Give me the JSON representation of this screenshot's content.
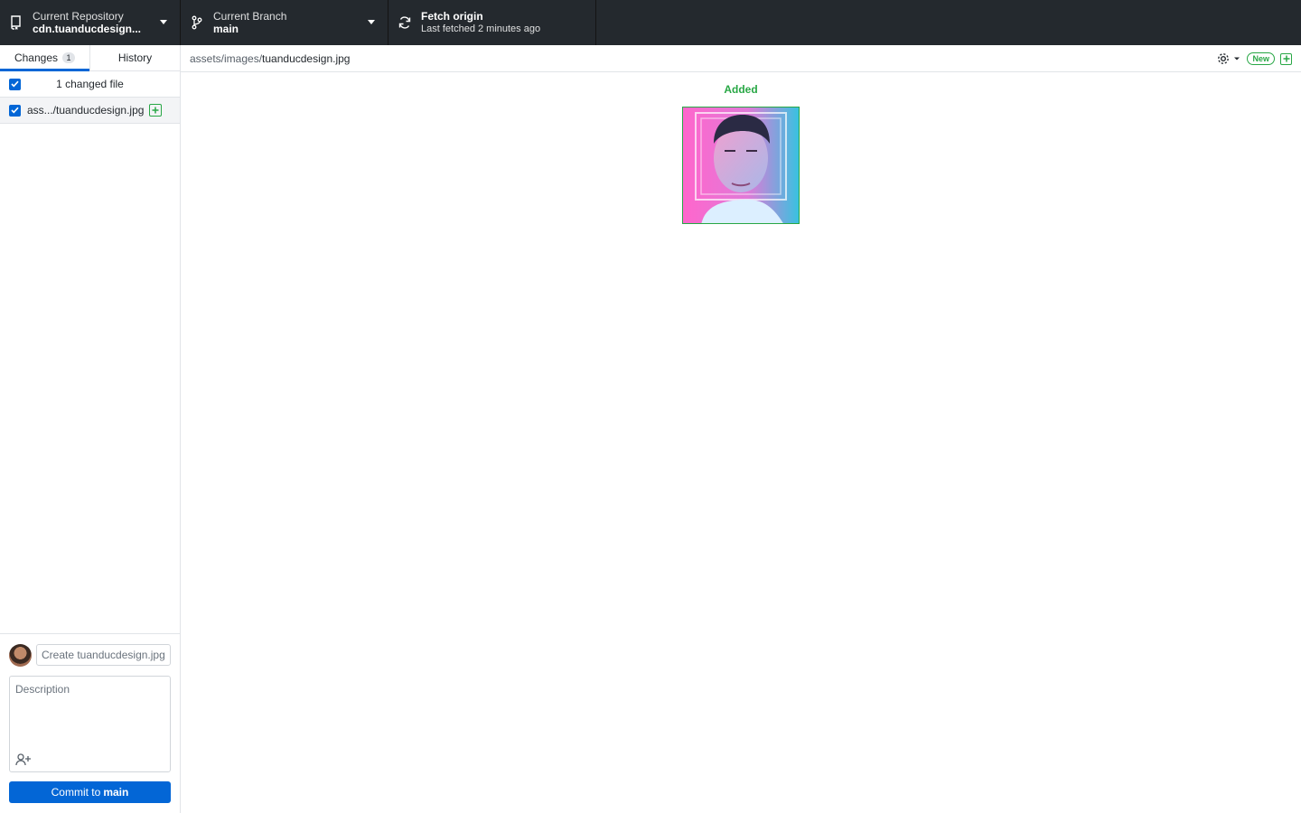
{
  "toolbar": {
    "repo": {
      "label": "Current Repository",
      "value": "cdn.tuanducdesign..."
    },
    "branch": {
      "label": "Current Branch",
      "value": "main"
    },
    "fetch": {
      "label": "Fetch origin",
      "sub": "Last fetched 2 minutes ago"
    }
  },
  "sidebar": {
    "tabs": [
      {
        "label": "Changes",
        "count": "1"
      },
      {
        "label": "History"
      }
    ],
    "changed_files_label": "1 changed file",
    "files": [
      {
        "name": "ass.../tuanducdesign.jpg",
        "status": "added"
      }
    ]
  },
  "commit": {
    "summary_placeholder": "Create tuanducdesign.jpg",
    "description_placeholder": "Description",
    "button_prefix": "Commit to",
    "button_branch": "main"
  },
  "diff": {
    "path_dir": "assets/images/",
    "path_file": "tuanducdesign.jpg",
    "badge_new": "New",
    "status_label": "Added"
  },
  "colors": {
    "toolbar_bg": "#24292e",
    "accent_blue": "#0366d6",
    "added_green": "#28a745"
  }
}
